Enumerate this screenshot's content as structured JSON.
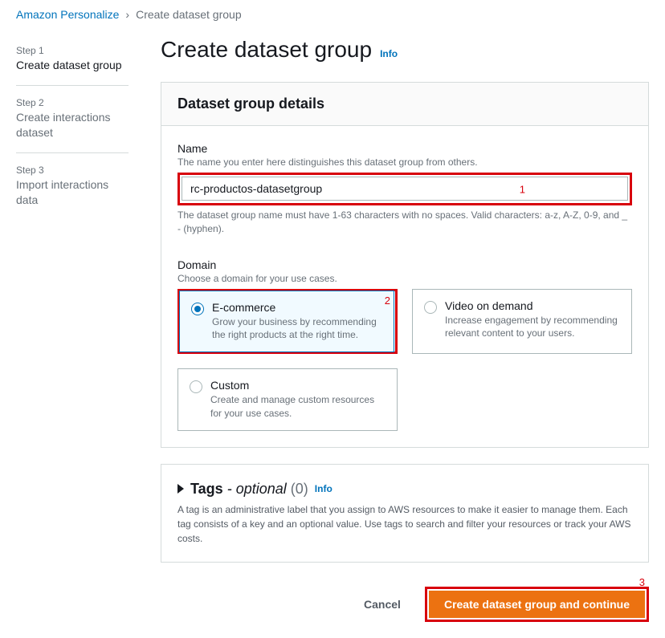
{
  "breadcrumb": {
    "root": "Amazon Personalize",
    "current": "Create dataset group"
  },
  "steps": [
    {
      "label": "Step 1",
      "title": "Create dataset group",
      "active": true
    },
    {
      "label": "Step 2",
      "title": "Create interactions dataset",
      "active": false
    },
    {
      "label": "Step 3",
      "title": "Import interactions data",
      "active": false
    }
  ],
  "page_title": "Create dataset group",
  "info_label": "Info",
  "details_panel": {
    "heading": "Dataset group details",
    "name_field": {
      "label": "Name",
      "desc": "The name you enter here distinguishes this dataset group from others.",
      "value": "rc-productos-datasetgroup",
      "help": "The dataset group name must have 1-63 characters with no spaces. Valid characters: a-z, A-Z, 0-9, and _ - (hyphen)."
    },
    "domain_field": {
      "label": "Domain",
      "desc": "Choose a domain for your use cases.",
      "options": [
        {
          "title": "E-commerce",
          "desc": "Grow your business by recommending the right products at the right time.",
          "selected": true
        },
        {
          "title": "Video on demand",
          "desc": "Increase engagement by recommending relevant content to your users.",
          "selected": false
        },
        {
          "title": "Custom",
          "desc": "Create and manage custom resources for your use cases.",
          "selected": false
        }
      ]
    }
  },
  "tags_panel": {
    "title": "Tags",
    "optional_text": "- optional",
    "count": "(0)",
    "info_label": "Info",
    "desc": "A tag is an administrative label that you assign to AWS resources to make it easier to manage them. Each tag consists of a key and an optional value. Use tags to search and filter your resources or track your AWS costs."
  },
  "footer": {
    "cancel": "Cancel",
    "primary": "Create dataset group and continue"
  },
  "annotations": {
    "a1": "1",
    "a2": "2",
    "a3": "3"
  }
}
